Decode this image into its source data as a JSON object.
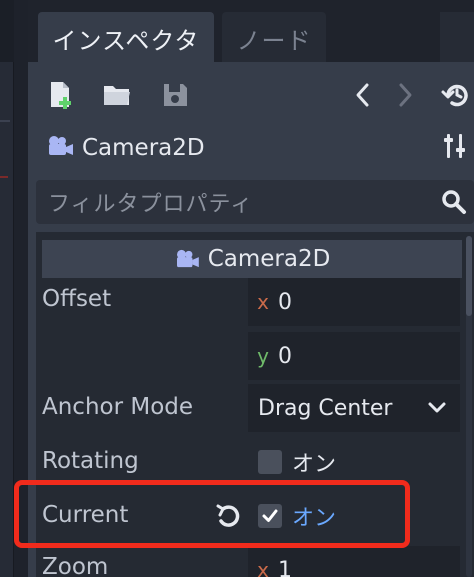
{
  "tabs": [
    {
      "label": "インスペクタ",
      "active": true
    },
    {
      "label": "ノード",
      "active": false
    }
  ],
  "toolbar": {
    "new_resource_icon": "new-file-icon",
    "open_icon": "folder-open-icon",
    "save_icon": "save-icon",
    "back_icon": "chevron-left-icon",
    "forward_icon": "chevron-right-icon",
    "history_icon": "history-icon"
  },
  "object": {
    "icon": "camera2d-icon",
    "name": "Camera2D",
    "tools_icon": "object-tools-icon"
  },
  "filter": {
    "placeholder": "フィルタプロパティ",
    "icon": "search-icon"
  },
  "section": {
    "title": "Camera2D",
    "icon": "camera2d-icon"
  },
  "properties": {
    "offset": {
      "label": "Offset",
      "x_axis": "x",
      "x": "0",
      "y_axis": "y",
      "y": "0"
    },
    "anchor_mode": {
      "label": "Anchor Mode",
      "value": "Drag Center"
    },
    "rotating": {
      "label": "Rotating",
      "checked": false,
      "text": "オン"
    },
    "current": {
      "label": "Current",
      "checked": true,
      "text": "オン",
      "revert_icon": "revert-icon"
    },
    "zoom": {
      "label": "Zoom",
      "x_axis": "x",
      "x": "1"
    }
  },
  "colors": {
    "accent": "#6aa8ff",
    "highlight": "#f12b1c",
    "axis_x": "#c96a4a",
    "axis_y": "#6fba6a"
  }
}
